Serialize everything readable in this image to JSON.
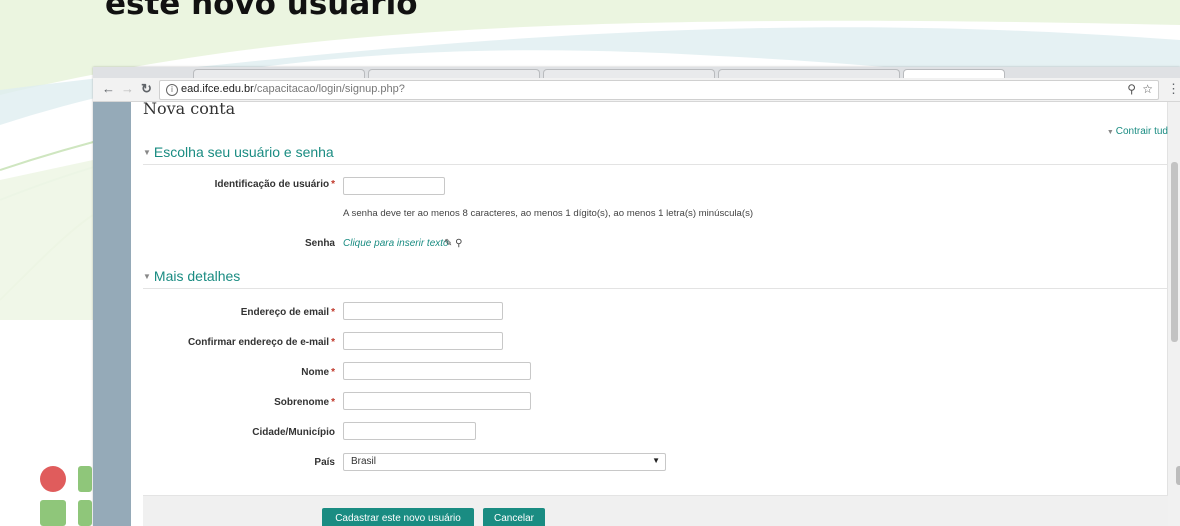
{
  "slide": {
    "title": "este novo usuário"
  },
  "browser": {
    "url_domain": "ead.ifce.edu.br",
    "url_path": "/capacitacao/login/signup.php?",
    "info_icon": "ⓘ"
  },
  "page": {
    "heading": "Nova conta",
    "collapse_all": "Contrair tud",
    "sections": [
      {
        "title": "Escolha seu usuário e senha"
      },
      {
        "title": "Mais detalhes"
      }
    ],
    "fields": {
      "username": {
        "label": "Identificação de usuário",
        "value": ""
      },
      "password_help": "A senha deve ter ao menos 8 caracteres, ao menos 1 dígito(s), ao menos 1 letra(s) minúscula(s)",
      "password": {
        "label": "Senha",
        "link": "Clique para inserir texto"
      },
      "email": {
        "label": "Endereço de email",
        "value": ""
      },
      "email_confirm": {
        "label": "Confirmar endereço de e-mail",
        "value": ""
      },
      "first_name": {
        "label": "Nome",
        "value": ""
      },
      "last_name": {
        "label": "Sobrenome",
        "value": ""
      },
      "city": {
        "label": "Cidade/Município",
        "value": ""
      },
      "country": {
        "label": "País",
        "value": "Brasil"
      }
    },
    "buttons": {
      "submit": "Cadastrar este novo usuário",
      "cancel": "Cancelar"
    }
  },
  "colors": {
    "accent": "#1a8c82",
    "required": "#c0392b",
    "rail": "#95aab8"
  }
}
